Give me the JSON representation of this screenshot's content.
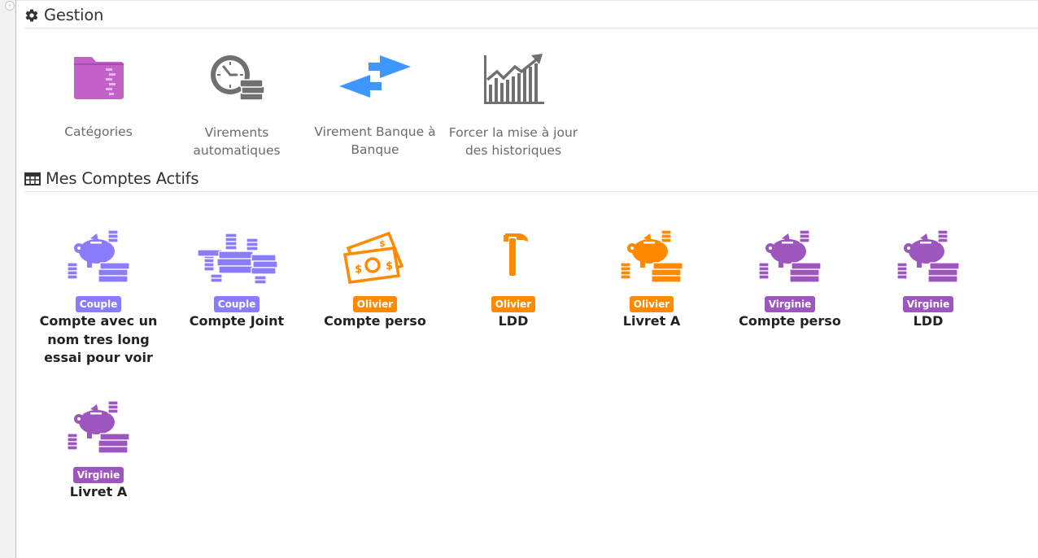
{
  "gestion": {
    "title": "Gestion",
    "items": [
      {
        "label": "Catégories",
        "icon": "folder-icon",
        "color": "#c261c6"
      },
      {
        "label": "Virements automatiques",
        "icon": "clock-money-icon",
        "color": "#707070"
      },
      {
        "label": "Virement Banque à Banque",
        "icon": "transfer-arrows-icon",
        "color": "#3d97ff"
      },
      {
        "label": "Forcer la mise à jour des historiques",
        "icon": "trend-chart-icon",
        "color": "#707070"
      }
    ]
  },
  "accounts": {
    "title": "Mes Comptes Actifs",
    "items": [
      {
        "owner": "Couple",
        "name": "Compte avec un nom tres long essai pour voir",
        "icon": "piggy-bank-icon",
        "color": "#8a7cfd"
      },
      {
        "owner": "Couple",
        "name": "Compte Joint",
        "icon": "money-stacks-icon",
        "color": "#8a7cfd"
      },
      {
        "owner": "Olivier",
        "name": "Compte perso",
        "icon": "banknotes-icon",
        "color": "#ff8a00"
      },
      {
        "owner": "Olivier",
        "name": "LDD",
        "icon": "hammer-icon",
        "color": "#ff8a00"
      },
      {
        "owner": "Olivier",
        "name": "Livret A",
        "icon": "piggy-bank-icon",
        "color": "#ff8a00"
      },
      {
        "owner": "Virginie",
        "name": "Compte perso",
        "icon": "piggy-bank-icon",
        "color": "#9d56bd"
      },
      {
        "owner": "Virginie",
        "name": "LDD",
        "icon": "piggy-bank-icon",
        "color": "#9d56bd"
      },
      {
        "owner": "Virginie",
        "name": "Livret A",
        "icon": "piggy-bank-icon",
        "color": "#9d56bd"
      }
    ]
  }
}
